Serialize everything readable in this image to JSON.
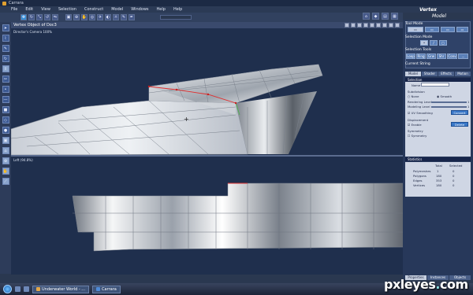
{
  "window": {
    "title": "Carrara",
    "workspace_label": "Vertex"
  },
  "menu": [
    "File",
    "Edit",
    "View",
    "Selection",
    "Construct",
    "Model",
    "Windows",
    "Help",
    "Help"
  ],
  "mode_label": "Model",
  "viewport_top": {
    "header": "Vertex Object of Doc3",
    "info": "Director's Camera 100%"
  },
  "viewport_bottom": {
    "info": "Left (94.8%)"
  },
  "panel": {
    "tool_mode_title": "Tool Mode",
    "selection_mode_title": "Selection Mode",
    "selection_tools_title": "Selection Tools",
    "selection_tools": [
      "Loop",
      "Ring",
      "Grw",
      "Shr",
      "Conv",
      "..."
    ],
    "current_string": "Current String",
    "tabs": [
      "Model",
      "Shader",
      "Effects",
      "Motion"
    ],
    "selection_section": "Selection",
    "name_label": "Name",
    "subdivision_label": "Subdivision",
    "subdivision_options": [
      "None",
      "Smooth"
    ],
    "rendering_level_label": "Rendering Level",
    "rendering_level_value": "1",
    "modeling_level_label": "Modeling Level",
    "modeling_level_value": "1",
    "uv_smoothing_label": "UV Smoothing",
    "convert_label": "Convert",
    "displacement_title": "Displacement",
    "enable_label": "Enable",
    "delete_label": "Delete",
    "symmetry_title": "Symmetry",
    "symmetry_label": "Symmetry",
    "statistics_section": "Statistics",
    "stats_headers": [
      "",
      "Total",
      "Selected"
    ],
    "stats": [
      {
        "label": "Polymeshes",
        "total": "1",
        "selected": "0"
      },
      {
        "label": "Polygons",
        "total": "180",
        "selected": "0"
      },
      {
        "label": "Edges",
        "total": "353",
        "selected": "0"
      },
      {
        "label": "Vertices",
        "total": "180",
        "selected": "0"
      }
    ],
    "bottom_tabs": [
      "Properties",
      "Instances",
      "Objects"
    ]
  },
  "taskbar": {
    "tasks": [
      "Underwater World - ...",
      "Carrara"
    ]
  },
  "watermark": {
    "brand": "pxleyes",
    "dot": ".",
    "tld": "com"
  },
  "colors": {
    "background": "#2a3850",
    "viewport": "#1f2f4d",
    "selection_edge": "#e03030",
    "accent": "#3a78c8"
  }
}
